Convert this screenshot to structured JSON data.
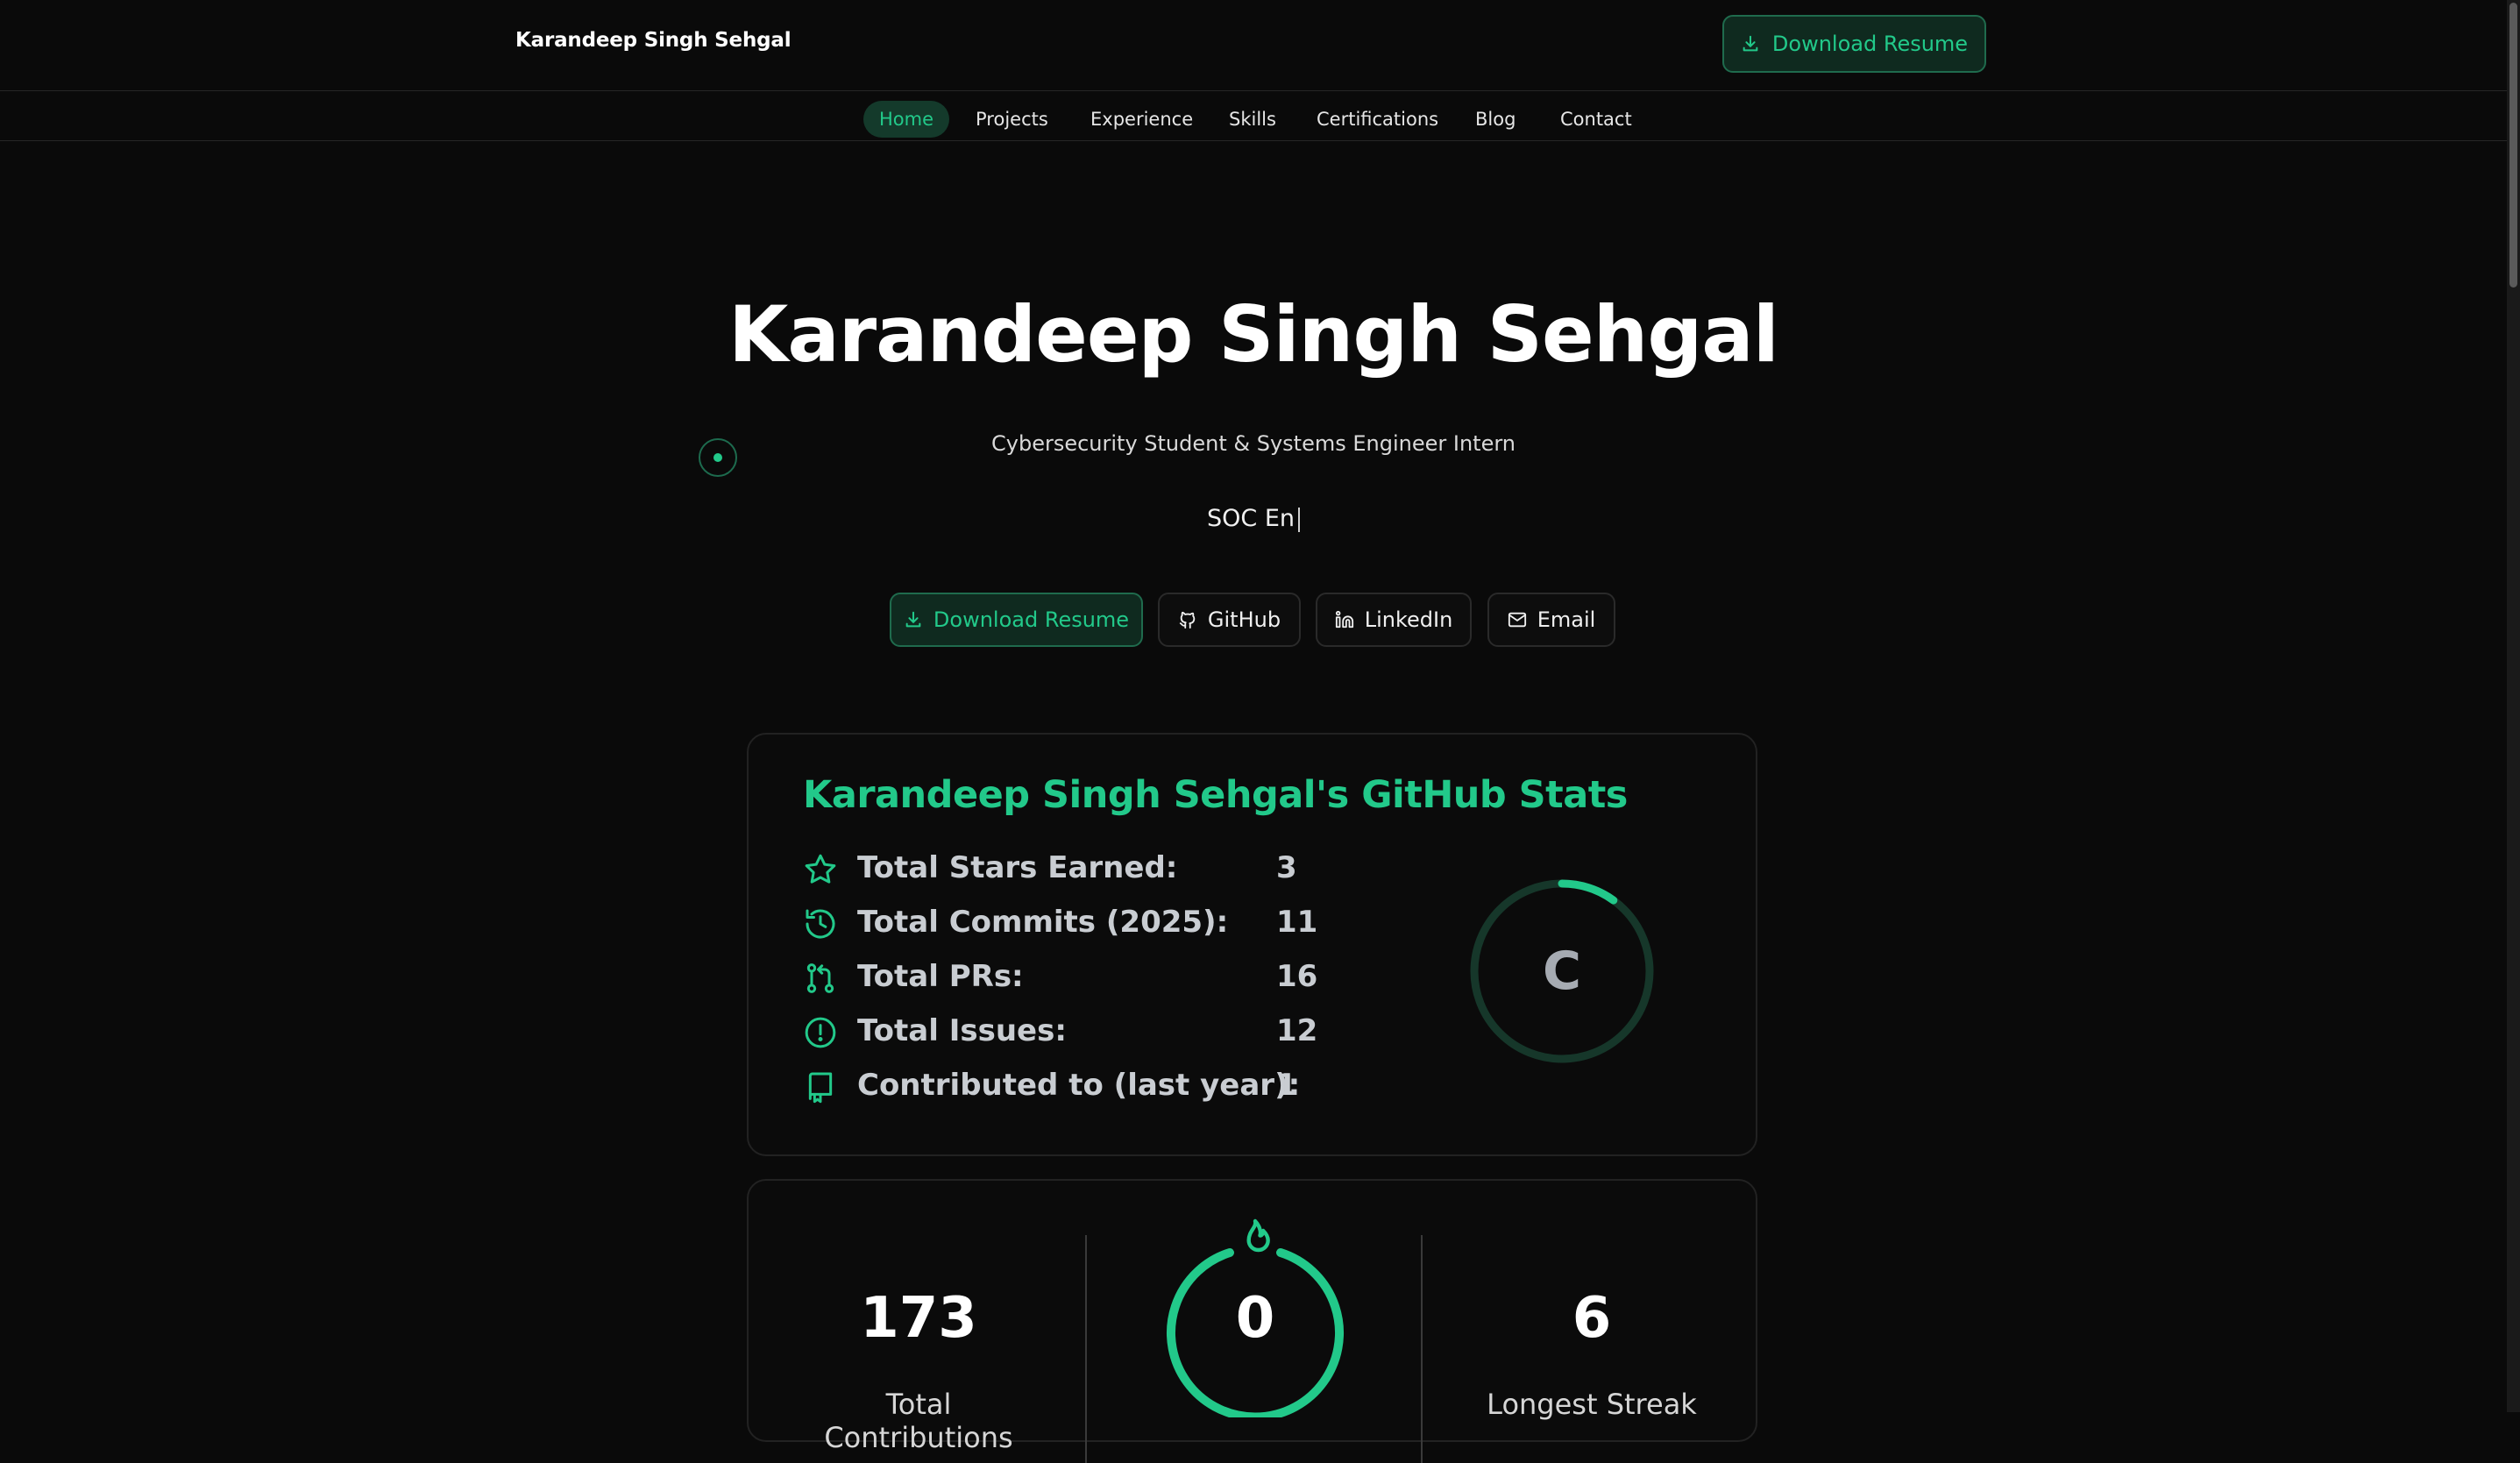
{
  "brand": "Karandeep Singh Sehgal",
  "header": {
    "download_label": "Download Resume"
  },
  "nav": [
    {
      "label": "Home",
      "active": true
    },
    {
      "label": "Projects"
    },
    {
      "label": "Experience"
    },
    {
      "label": "Skills"
    },
    {
      "label": "Certifications"
    },
    {
      "label": "Blog"
    },
    {
      "label": "Contact"
    }
  ],
  "hero": {
    "title": "Karandeep Singh Sehgal",
    "subtitle": "Cybersecurity Student & Systems Engineer Intern",
    "typing": "SOC En"
  },
  "buttons": {
    "download": "Download Resume",
    "github": "GitHub",
    "linkedin": "LinkedIn",
    "email": "Email"
  },
  "github_stats": {
    "title": "Karandeep Singh Sehgal's GitHub Stats",
    "rows": [
      {
        "icon": "star-icon",
        "label": "Total Stars Earned:",
        "value": "3"
      },
      {
        "icon": "history-icon",
        "label": "Total Commits (2025):",
        "value": "11"
      },
      {
        "icon": "pull-request-icon",
        "label": "Total PRs:",
        "value": "16"
      },
      {
        "icon": "issue-icon",
        "label": "Total Issues:",
        "value": "12"
      },
      {
        "icon": "repo-icon",
        "label": "Contributed to (last year):",
        "value": "1"
      }
    ],
    "grade": "C",
    "grade_progress": 0.1
  },
  "streak": {
    "total_value": "173",
    "total_label": "Total Contributions",
    "current_value": "0",
    "longest_value": "6",
    "longest_label": "Longest Streak"
  },
  "colors": {
    "accent": "#22c98a",
    "background": "#0a0a0a",
    "button_bg": "#0f2a1f",
    "stat_text": "#c9cdd2"
  }
}
